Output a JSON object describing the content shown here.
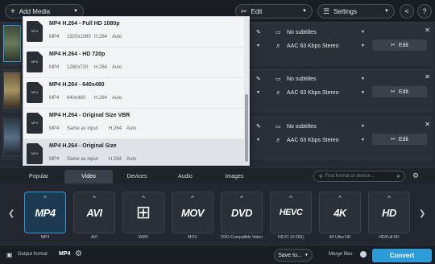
{
  "toolbar": {
    "add_media": "Add Media",
    "edit": "Edit",
    "settings": "Settings"
  },
  "files": [
    {
      "subtitles": "No subtitles",
      "audio": "AAC 63 Kbps Stereo",
      "edit": "Edit"
    },
    {
      "subtitles": "No subtitles",
      "audio": "AAC 63 Kbps Stereo",
      "edit": "Edit"
    },
    {
      "subtitles": "No subtitles",
      "audio": "AAC 63 Kbps Stereo",
      "edit": "Edit"
    }
  ],
  "dropdown": {
    "items": [
      {
        "icon_text": "MP4",
        "title": "MP4 H.264 - Full HD 1080p",
        "specs": [
          "MP4",
          "1920x1080",
          "H.264",
          "Auto"
        ]
      },
      {
        "icon_text": "MP4",
        "title": "MP4 H.264 - HD 720p",
        "specs": [
          "MP4",
          "1280x720",
          "H.264",
          "Auto"
        ]
      },
      {
        "icon_text": "MP4",
        "title": "MP4 H.264 - 640x480",
        "specs": [
          "MP4",
          "640x480",
          "H.264",
          "Auto"
        ]
      },
      {
        "icon_text": "MP4",
        "title": "MP4 H.264 - Original Size VBR",
        "specs": [
          "MP4",
          "Same as input",
          "H.264",
          "Auto"
        ]
      },
      {
        "icon_text": "MP4",
        "title": "MP4 H.264 - Original Size",
        "specs": [
          "MP4",
          "Same as input",
          "H.264",
          "Auto"
        ]
      }
    ]
  },
  "tabs": [
    "Popular",
    "Video",
    "Devices",
    "Audio",
    "Images"
  ],
  "active_tab": "Video",
  "search_placeholder": "Find format or device...",
  "formats": [
    {
      "label": "MP4",
      "name": "MP4"
    },
    {
      "label": "AVI",
      "name": "AVI"
    },
    {
      "label": "WMV",
      "name": "WMV"
    },
    {
      "label": "MOV",
      "name": "MOV"
    },
    {
      "label": "DVD",
      "name": "DVD-Compatible Video"
    },
    {
      "label": "HEVC",
      "name": "HEVC (H.265)"
    },
    {
      "label": "4K",
      "name": "4K Ultra HD"
    },
    {
      "label": "HD",
      "name": "HD/Full HD"
    }
  ],
  "bottom": {
    "output_format_label": "Output format:",
    "output_format_value": "MP4",
    "save_to": "Save to...",
    "merge_files": "Merge files:",
    "convert": "Convert"
  },
  "colors": {
    "accent": "#2e9bd9",
    "dark_bg": "#1c2128"
  }
}
